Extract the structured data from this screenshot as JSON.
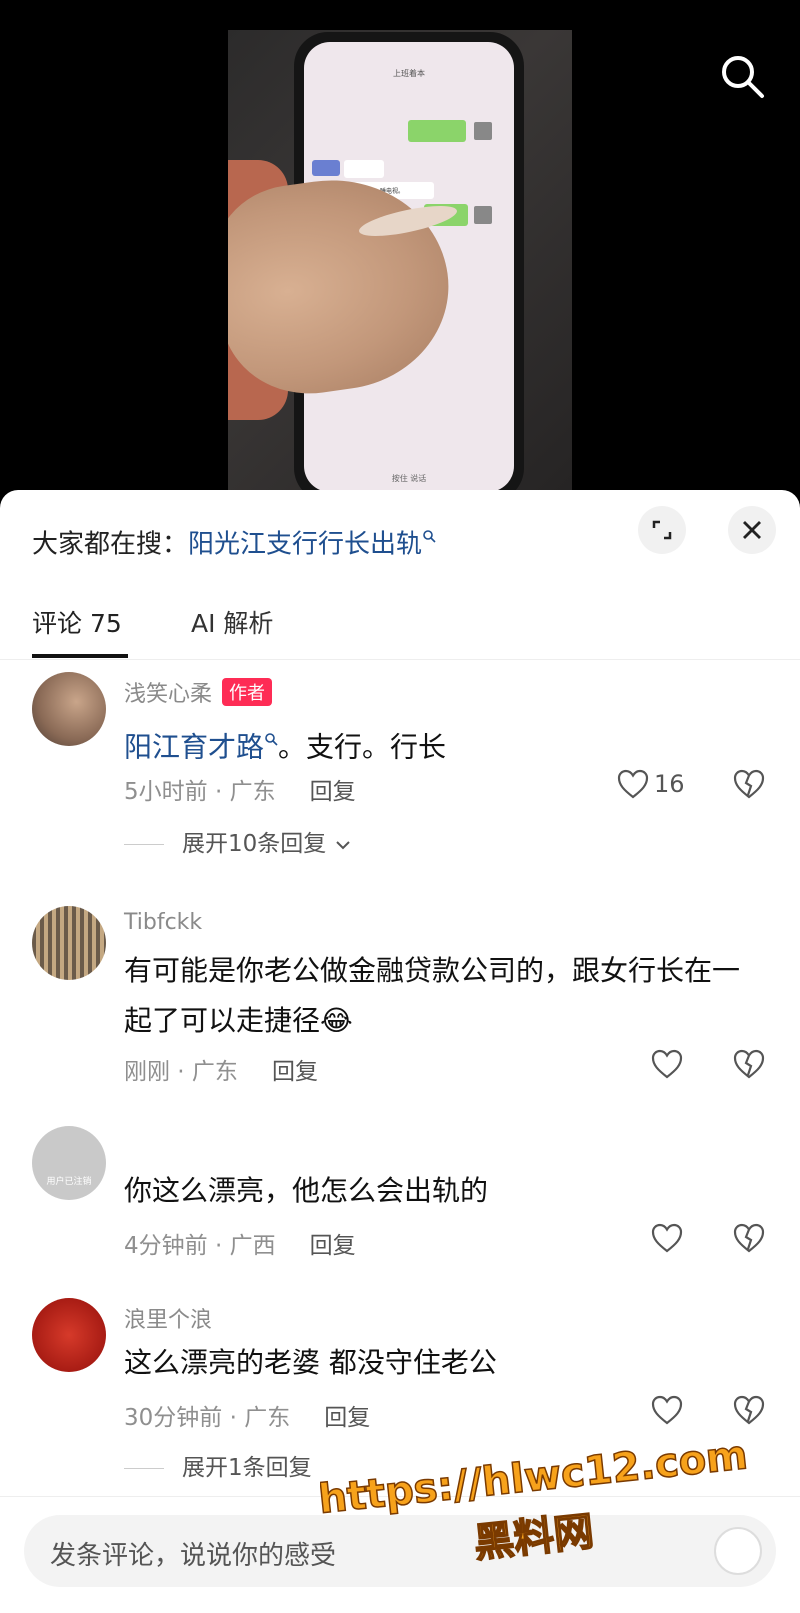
{
  "video": {
    "phone_screen_title": "上班着本",
    "phone_chat_text": "行老板出去啊。睡电视。",
    "phone_footer": "按住 说话"
  },
  "header": {
    "search_prefix": "大家都在搜：",
    "search_keyword": "阳光江支行行长出轨"
  },
  "tabs": [
    {
      "label": "评论 75",
      "active": true
    },
    {
      "label": "AI 解析",
      "active": false
    }
  ],
  "comments": [
    {
      "name": "浅笑心柔",
      "badge": "作者",
      "text_link": "阳江育才路",
      "text_rest": "。支行。行长",
      "time": "5小时前 · 广东",
      "reply": "回复",
      "likes": "16",
      "expand": "展开10条回复"
    },
    {
      "name": "Tibfckk",
      "text": "有可能是你老公做金融贷款公司的，跟女行长在一起了可以走捷径",
      "emoji": "😂",
      "time": "刚刚 · 广东",
      "reply": "回复"
    },
    {
      "name": "",
      "avatar_text": "用户已注销",
      "text": "你这么漂亮，他怎么会出轨的",
      "time": "4分钟前 · 广西",
      "reply": "回复"
    },
    {
      "name": "浪里个浪",
      "text": "这么漂亮的老婆   都没守住老公",
      "time": "30分钟前 · 广东",
      "reply": "回复",
      "expand": "展开1条回复"
    }
  ],
  "input": {
    "placeholder": "发条评论，说说你的感受"
  },
  "watermark": {
    "url": "https://hlwc12.com",
    "name": "黑料网"
  },
  "colors": {
    "accent_red": "#fe2c55",
    "link_blue": "#1f4f8f",
    "watermark_orange": "#f7a21b"
  }
}
